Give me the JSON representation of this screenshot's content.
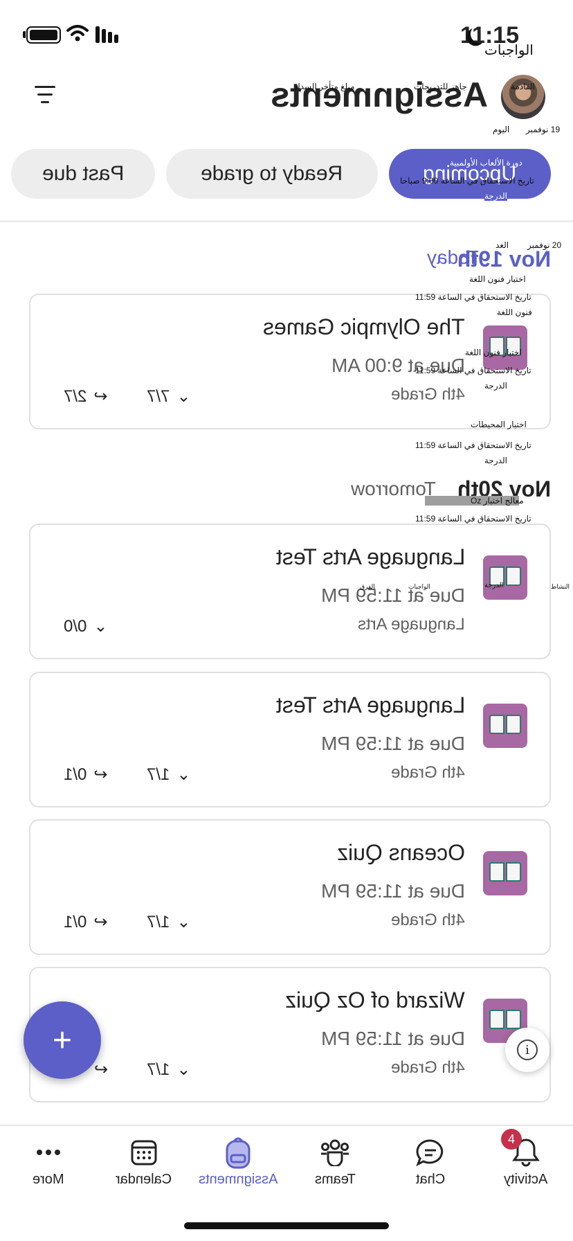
{
  "status_bar": {
    "time": "11:15",
    "subtitle": "الواجبات"
  },
  "header": {
    "title": "Assignments",
    "avatar_caption": "القادمة",
    "overlay_left": "مبلغ متأخر السداد",
    "overlay_mid": "جاهز للتدريجات",
    "date_ar": "19 نوفمبر",
    "today_ar": "اليوم"
  },
  "filters": [
    {
      "label": "Upcoming",
      "active": true
    },
    {
      "label": "Ready to grade",
      "active": false
    },
    {
      "label": "Past due",
      "active": false
    }
  ],
  "upcoming_overlay": {
    "line1": "دورة الألعاب الأولمبية",
    "line2": "تاريخ الاستحقاق في الساعة 9:00 صباحا",
    "line3": "الدرجة"
  },
  "sections": [
    {
      "date": "Nov 19th",
      "relative": "Today"
    },
    {
      "date": "Nov 20th",
      "relative": "Tomorrow"
    }
  ],
  "cards": [
    {
      "title": "The Olympic Games",
      "due": "Due at 9:00 AM",
      "class": "4th Grade",
      "turned_in": "7/7",
      "returned": "2/7"
    },
    {
      "title": "Language Arts Test",
      "due": "Due at 11:59 PM",
      "class": "Language Arts",
      "turned_in": "0/0",
      "returned": ""
    },
    {
      "title": "Language Arts Test",
      "due": "Due at 11:59 PM",
      "class": "4th Grade",
      "turned_in": "1/7",
      "returned": "0/1"
    },
    {
      "title": "Oceans Quiz",
      "due": "Due at 11:59 PM",
      "class": "4th Grade",
      "turned_in": "1/7",
      "returned": "0/1"
    },
    {
      "title": "Wizard of Oz Quiz",
      "due": "Due at 11:59 PM",
      "class": "4th Grade",
      "turned_in": "1/7",
      "returned": ""
    }
  ],
  "overlay_list": {
    "date20": "20 نوفمبر",
    "tomorrow": "الغد",
    "la_test": "اختبار فنون اللغة",
    "due1159": "تاريخ الاستحقاق في الساعة 11:59",
    "la": "فنون اللغة",
    "grade": "الدرجة",
    "oceans": "اختبار المحيطات",
    "oz": "معالج اختبار Oz",
    "activity": "النشاط",
    "teams_small": "الفرق",
    "assign_small": "الواجبات"
  },
  "nav": [
    {
      "label": "More",
      "icon": "more-icon",
      "active": false
    },
    {
      "label": "Calendar",
      "icon": "calendar-icon",
      "active": false
    },
    {
      "label": "Assignments",
      "icon": "backpack-icon",
      "active": true
    },
    {
      "label": "Teams",
      "icon": "teams-icon",
      "active": false
    },
    {
      "label": "Chat",
      "icon": "chat-icon",
      "active": false
    },
    {
      "label": "Activity",
      "icon": "bell-icon",
      "active": false
    }
  ],
  "activity_badge": "4",
  "fab_label": "+",
  "info_label": "i",
  "colors": {
    "accent": "#5b5fc7",
    "icon_bg": "#a868a3",
    "badge": "#c4314b"
  }
}
